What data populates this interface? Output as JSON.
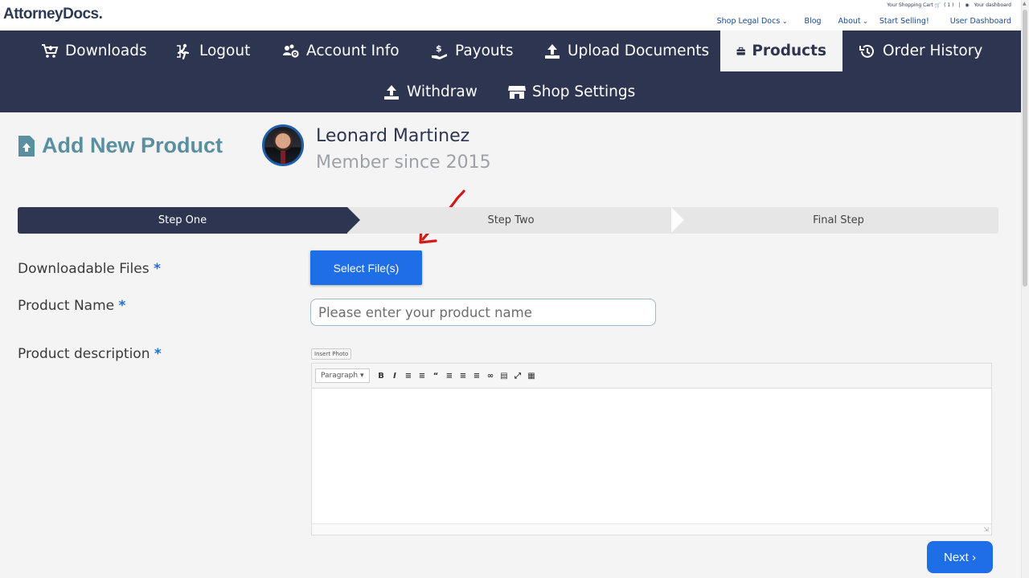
{
  "header": {
    "logo": "AttorneyDocs.",
    "cart_text": "Your Shopping Cart",
    "cart_count": "( 1 )",
    "separator": "|",
    "dashboard_mini": "Your dashboard",
    "links": [
      "Shop Legal Docs",
      "Blog",
      "About",
      "Start Selling!",
      "User Dashboard"
    ]
  },
  "nav": {
    "items": [
      {
        "label": "Downloads",
        "icon": "cart-download-icon"
      },
      {
        "label": "Logout",
        "icon": "logout-icon"
      },
      {
        "label": "Account Info",
        "icon": "users-gear-icon"
      },
      {
        "label": "Payouts",
        "icon": "hand-dollar-icon"
      },
      {
        "label": "Upload Documents",
        "icon": "upload-icon"
      },
      {
        "label": "Products",
        "icon": "briefcase-icon",
        "active": true
      },
      {
        "label": "Order History",
        "icon": "history-icon"
      },
      {
        "label": "Withdraw",
        "icon": "upload-icon"
      },
      {
        "label": "Shop Settings",
        "icon": "store-icon"
      }
    ]
  },
  "page": {
    "title": "Add New Product",
    "user_name": "Leonard Martinez",
    "member_since": "Member since 2015"
  },
  "steps": [
    "Step One",
    "Step Two",
    "Final Step"
  ],
  "form": {
    "files_label": "Downloadable Files",
    "select_files_label": "Select File(s)",
    "name_label": "Product Name",
    "name_placeholder": "Please enter your product name",
    "desc_label": "Product description",
    "insert_photo": "Insert Photo",
    "paragraph_select": "Paragraph",
    "required_mark": "*",
    "next_label": "Next"
  },
  "colors": {
    "nav_bg": "#2e3550",
    "primary_button": "#1e6ee8",
    "title_teal": "#5a8fa0",
    "annotation_red": "#d11a1a"
  }
}
